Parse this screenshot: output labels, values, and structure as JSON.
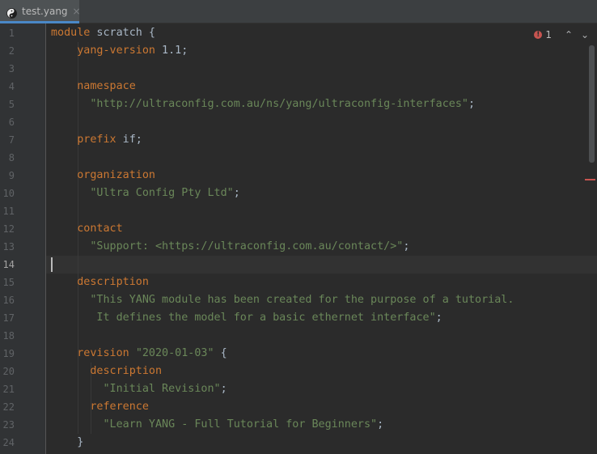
{
  "tab": {
    "label": "test.yang",
    "close_glyph": "×",
    "icon": "yang-file-icon"
  },
  "inspection": {
    "error_count": "1",
    "error_glyph": "!",
    "prev_glyph": "⌃",
    "next_glyph": "⌄"
  },
  "current_line": 14,
  "colors": {
    "keyword": "#cc7832",
    "string": "#6a8759",
    "plain": "#a9b7c6",
    "background": "#2b2b2b",
    "gutter": "#313335"
  },
  "lines": [
    {
      "num": "1",
      "tokens": [
        {
          "t": "kw",
          "v": "module"
        },
        {
          "t": "plain",
          "v": " scratch {"
        }
      ]
    },
    {
      "num": "2",
      "tokens": [
        {
          "t": "plain",
          "v": "    "
        },
        {
          "t": "kw",
          "v": "yang-version"
        },
        {
          "t": "plain",
          "v": " 1.1;"
        }
      ]
    },
    {
      "num": "3",
      "tokens": []
    },
    {
      "num": "4",
      "tokens": [
        {
          "t": "plain",
          "v": "    "
        },
        {
          "t": "kw",
          "v": "namespace"
        }
      ]
    },
    {
      "num": "5",
      "tokens": [
        {
          "t": "plain",
          "v": "      "
        },
        {
          "t": "str",
          "v": "\"http://ultraconfig.com.au/ns/yang/ultraconfig-interfaces\""
        },
        {
          "t": "plain",
          "v": ";"
        }
      ]
    },
    {
      "num": "6",
      "tokens": []
    },
    {
      "num": "7",
      "tokens": [
        {
          "t": "plain",
          "v": "    "
        },
        {
          "t": "kw",
          "v": "prefix"
        },
        {
          "t": "plain",
          "v": " if;"
        }
      ]
    },
    {
      "num": "8",
      "tokens": []
    },
    {
      "num": "9",
      "tokens": [
        {
          "t": "plain",
          "v": "    "
        },
        {
          "t": "kw",
          "v": "organization"
        }
      ]
    },
    {
      "num": "10",
      "tokens": [
        {
          "t": "plain",
          "v": "      "
        },
        {
          "t": "str",
          "v": "\"Ultra Config Pty Ltd\""
        },
        {
          "t": "plain",
          "v": ";"
        }
      ]
    },
    {
      "num": "11",
      "tokens": []
    },
    {
      "num": "12",
      "tokens": [
        {
          "t": "plain",
          "v": "    "
        },
        {
          "t": "kw",
          "v": "contact"
        }
      ]
    },
    {
      "num": "13",
      "tokens": [
        {
          "t": "plain",
          "v": "      "
        },
        {
          "t": "str",
          "v": "\"Support: <https://ultraconfig.com.au/contact/>\""
        },
        {
          "t": "plain",
          "v": ";"
        }
      ]
    },
    {
      "num": "14",
      "tokens": []
    },
    {
      "num": "15",
      "tokens": [
        {
          "t": "plain",
          "v": "    "
        },
        {
          "t": "kw",
          "v": "description"
        }
      ]
    },
    {
      "num": "16",
      "tokens": [
        {
          "t": "plain",
          "v": "      "
        },
        {
          "t": "str",
          "v": "\"This YANG module has been created for the purpose of a tutorial."
        }
      ]
    },
    {
      "num": "17",
      "tokens": [
        {
          "t": "str",
          "v": "       It defines the model for a basic ethernet interface\""
        },
        {
          "t": "plain",
          "v": ";"
        }
      ]
    },
    {
      "num": "18",
      "tokens": []
    },
    {
      "num": "19",
      "tokens": [
        {
          "t": "plain",
          "v": "    "
        },
        {
          "t": "kw",
          "v": "revision"
        },
        {
          "t": "plain",
          "v": " "
        },
        {
          "t": "str",
          "v": "\"2020-01-03\""
        },
        {
          "t": "plain",
          "v": " {"
        }
      ]
    },
    {
      "num": "20",
      "tokens": [
        {
          "t": "plain",
          "v": "      "
        },
        {
          "t": "kw",
          "v": "description"
        }
      ]
    },
    {
      "num": "21",
      "tokens": [
        {
          "t": "plain",
          "v": "        "
        },
        {
          "t": "str",
          "v": "\"Initial Revision\""
        },
        {
          "t": "plain",
          "v": ";"
        }
      ]
    },
    {
      "num": "22",
      "tokens": [
        {
          "t": "plain",
          "v": "      "
        },
        {
          "t": "kw",
          "v": "reference"
        }
      ]
    },
    {
      "num": "23",
      "tokens": [
        {
          "t": "plain",
          "v": "        "
        },
        {
          "t": "str",
          "v": "\"Learn YANG - Full Tutorial for Beginners\""
        },
        {
          "t": "plain",
          "v": ";"
        }
      ]
    },
    {
      "num": "24",
      "tokens": [
        {
          "t": "plain",
          "v": "    }"
        }
      ]
    }
  ]
}
